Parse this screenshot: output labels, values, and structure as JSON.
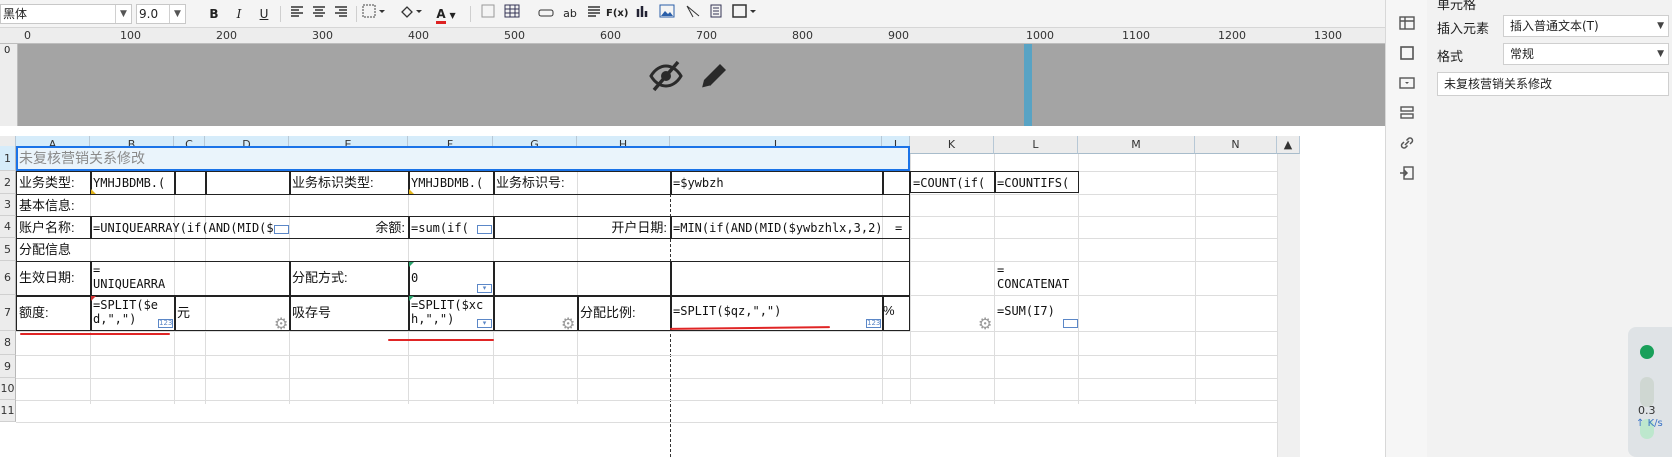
{
  "toolbar": {
    "font_name": "黑体",
    "font_size": "9.0",
    "bold": "B",
    "italic": "I",
    "underline": "U",
    "font_color_glyph": "A",
    "ab_glyph": "ab",
    "fx_glyph": "F(x)"
  },
  "ruler": {
    "marks": [
      "0",
      "100",
      "200",
      "300",
      "400",
      "500",
      "600",
      "700",
      "800",
      "900",
      "1000",
      "1100",
      "1200",
      "1300"
    ],
    "vertical_mark": "0"
  },
  "columns": [
    "A",
    "B",
    "C",
    "D",
    "E",
    "F",
    "G",
    "H",
    "I",
    "J",
    "K",
    "L",
    "M",
    "N"
  ],
  "rows": [
    "1",
    "2",
    "3",
    "4",
    "5",
    "6",
    "7",
    "8",
    "9",
    "10",
    "11"
  ],
  "cells": {
    "r1_title": "未复核营销关系修改",
    "r2_a": "业务类型:",
    "r2_b": "YMHJBDMB.(",
    "r2_e": "业务标识类型:",
    "r2_f": "YMHJBDMB.(",
    "r2_g": "业务标识号:",
    "r2_i": "=$ywbzh",
    "r2_k": "=COUNT(if(",
    "r2_l": "=COUNTIFS(",
    "r3_a": "基本信息:",
    "r4_a": "账户名称:",
    "r4_b": "=UNIQUEARRAY(if(AND(MID($",
    "r4_e": "余额:",
    "r4_f": "=sum(if(",
    "r4_h": "开户日期:",
    "r4_i": "=MIN(if(AND(MID($ywbzhlx,3,2)",
    "r4_j": "=",
    "r5_a": "分配信息",
    "r6_a": "生效日期:",
    "r6_b": "=\nUNIQUEARRA",
    "r6_e": "分配方式:",
    "r6_f": "0",
    "r6_l": "=\nCONCATENAT",
    "r7_a": "额度:",
    "r7_b": "=SPLIT($ed,\",\")",
    "r7_c": "元",
    "r7_e": "吸存号",
    "r7_f": "=SPLIT($xch,\",\")",
    "r7_h": "分配比例:",
    "r7_i": "=SPLIT($qz,\",\")",
    "r7_j": "%",
    "r7_l": "=SUM(I7)",
    "mini_badge": "123"
  },
  "panel": {
    "top_label": "单元格",
    "insert_label": "插入元素",
    "insert_value": "插入普通文本(T)",
    "format_label": "格式",
    "format_value": "常规",
    "text_value": "未复核营销关系修改"
  },
  "net": {
    "speed": "0.3",
    "unit": "K/s"
  },
  "colors": {
    "accent": "#1a73e8",
    "red_mark": "#e02525",
    "preview_bg": "#a4a4a4",
    "col_header_selected": "#d6ecfa"
  }
}
